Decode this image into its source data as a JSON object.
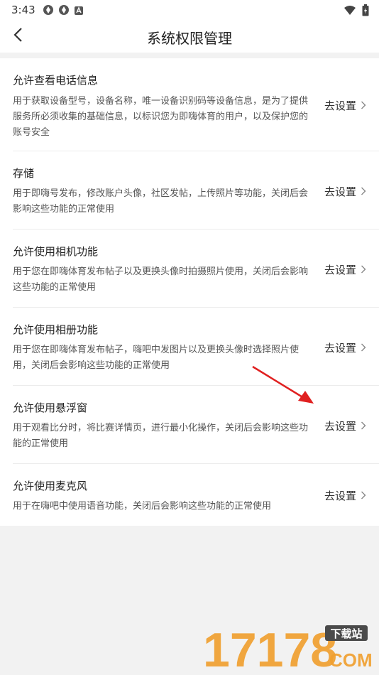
{
  "status_bar": {
    "time": "3:43",
    "icons_left": [
      "notification-icon",
      "notification-icon",
      "app-icon"
    ],
    "icons_right": [
      "wifi-icon",
      "battery-icon"
    ]
  },
  "header": {
    "title": "系统权限管理"
  },
  "permissions": [
    {
      "title": "允许查看电话信息",
      "description": "用于获取设备型号，设备名称，唯一设备识别码等设备信息，是为了提供服务所必须收集的基础信息，以标识您为即嗨体育的用户，以及保护您的账号安全",
      "action": "去设置"
    },
    {
      "title": "存储",
      "description": "用于即嗨号发布，修改账户头像，社区发帖，上传照片等功能，关闭后会影响这些功能的正常使用",
      "action": "去设置"
    },
    {
      "title": "允许使用相机功能",
      "description": "用于您在即嗨体育发布帖子以及更换头像时拍摄照片使用，关闭后会影响这些功能的正常使用",
      "action": "去设置"
    },
    {
      "title": "允许使用相册功能",
      "description": "用于您在即嗨体育发布帖子，嗨吧中发图片以及更换头像时选择照片使用，关闭后会影响这些功能的正常使用",
      "action": "去设置"
    },
    {
      "title": "允许使用悬浮窗",
      "description": "用于观看比分时，将比赛详情页，进行最小化操作，关闭后会影响这些功能的正常使用",
      "action": "去设置"
    },
    {
      "title": "允许使用麦克风",
      "description": "用于在嗨吧中使用语音功能，关闭后会影响这些功能的正常使用",
      "action": "去设置"
    }
  ],
  "annotation": {
    "arrow_color": "#e02020"
  },
  "watermark": {
    "number": "17178",
    "badge": "下载站",
    "domain": "COM",
    "color": "#f0a030"
  }
}
